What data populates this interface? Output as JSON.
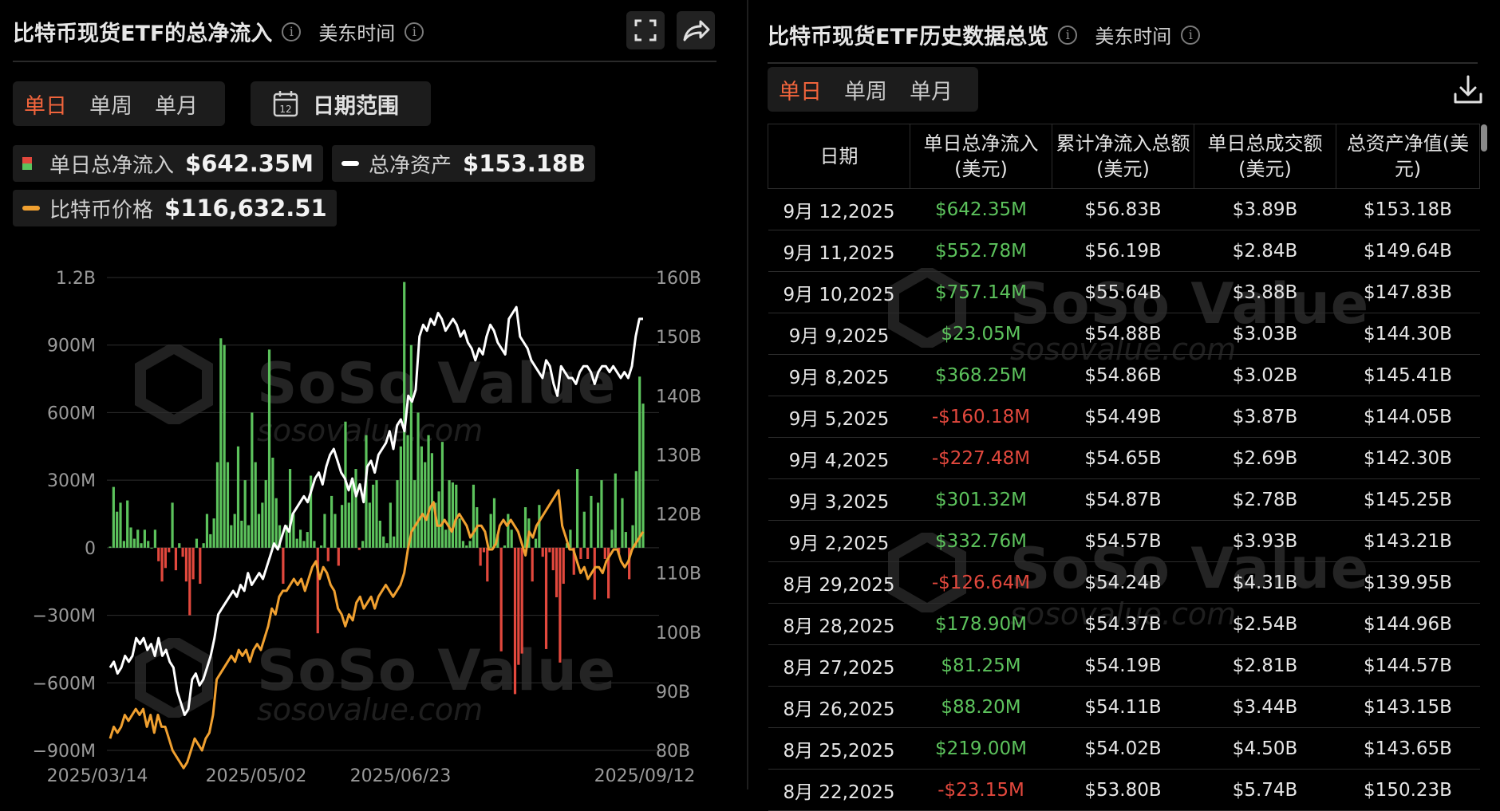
{
  "left": {
    "title": "比特币现货ETF的总净流入",
    "timezone": "美东时间",
    "tabs": [
      "单日",
      "单周",
      "单月"
    ],
    "active_tab": "单日",
    "date_range_label": "日期范围",
    "legend": {
      "net_inflow_label": "单日总净流入",
      "net_inflow_value": "$642.35M",
      "net_assets_label": "总净资产",
      "net_assets_value": "$153.18B",
      "btc_price_label": "比特币价格",
      "btc_price_value": "$116,632.51"
    },
    "colors": {
      "positive": "#5cc25c",
      "negative": "#e2483d",
      "net_assets_line": "#ffffff",
      "btc_price_line": "#f0a030",
      "accent": "#f0643c"
    }
  },
  "chart_data": {
    "type": "bar",
    "title": "比特币现货ETF的总净流入",
    "x_ticks": [
      "2025/03/14",
      "2025/05/02",
      "2025/06/23",
      "2025/09/12"
    ],
    "y_left_ticks": [
      "1.2B",
      "900M",
      "600M",
      "300M",
      "0",
      "−300M",
      "−600M",
      "−900M"
    ],
    "y_left_range": [
      -900,
      1200
    ],
    "y_left_unit": "M",
    "y_right_ticks": [
      "160B",
      "150B",
      "140B",
      "130B",
      "120B",
      "110B",
      "100B",
      "90B",
      "80B"
    ],
    "y_right_range": [
      80,
      160
    ],
    "grid": true,
    "series": [
      {
        "name": "单日总净流入",
        "kind": "bar",
        "values": [
          5,
          270,
          160,
          200,
          30,
          210,
          90,
          40,
          80,
          20,
          80,
          30,
          0,
          80,
          -60,
          -150,
          -90,
          -20,
          200,
          -100,
          20,
          -40,
          -150,
          -300,
          -140,
          40,
          -160,
          20,
          150,
          60,
          130,
          380,
          930,
          900,
          380,
          100,
          150,
          450,
          120,
          300,
          100,
          600,
          380,
          150,
          200,
          300,
          880,
          400,
          220,
          100,
          -160,
          100,
          350,
          150,
          40,
          80,
          30,
          70,
          320,
          30,
          -380,
          10,
          150,
          -60,
          230,
          150,
          -80,
          190,
          560,
          200,
          300,
          350,
          -10,
          30,
          500,
          200,
          280,
          300,
          120,
          50,
          20,
          200,
          50,
          300,
          450,
          1180,
          500,
          900,
          300,
          600,
          450,
          380,
          500,
          420,
          200,
          250,
          470,
          80,
          300,
          290,
          280,
          130,
          30,
          10,
          30,
          280,
          180,
          -80,
          -20,
          -150,
          150,
          220,
          60,
          -460,
          10,
          150,
          80,
          -650,
          -520,
          -470,
          180,
          130,
          -150,
          40,
          190,
          -40,
          -450,
          -20,
          -100,
          -220,
          -510,
          -160,
          20,
          80,
          -120,
          350,
          -50,
          160,
          -50,
          230,
          -230,
          200,
          300,
          -50,
          -225,
          80,
          330,
          -25,
          220,
          70,
          -140,
          100,
          340,
          760,
          640
        ],
        "color_positive": "#5cc25c",
        "color_negative": "#e2483d"
      },
      {
        "name": "总净资产",
        "kind": "line",
        "axis": "right",
        "color": "#ffffff",
        "values": [
          94,
          95,
          93,
          94,
          96,
          95,
          96,
          99,
          98,
          99,
          97,
          98,
          96,
          99,
          96,
          97,
          95,
          94,
          90,
          88,
          86,
          87,
          92,
          93,
          91,
          92,
          94,
          96,
          99,
          103,
          104,
          105,
          106,
          107,
          106,
          108,
          107,
          110,
          108,
          109,
          110,
          109,
          111,
          113,
          115,
          114,
          116,
          118,
          117,
          120,
          121,
          122,
          123,
          122,
          124,
          126,
          127,
          125,
          128,
          130,
          131,
          129,
          127,
          126,
          124,
          126,
          123,
          125,
          122,
          128,
          129,
          127,
          130,
          131,
          132,
          134,
          131,
          135,
          136,
          134,
          140,
          139,
          141,
          150,
          152,
          151,
          153,
          152,
          154,
          153,
          151,
          152,
          153,
          152,
          150,
          151,
          149,
          148,
          146,
          148,
          147,
          150,
          152,
          151,
          149,
          148,
          147,
          153,
          154,
          155,
          150,
          149,
          148,
          146,
          145,
          144,
          143,
          146,
          145,
          142,
          140,
          145,
          144,
          143,
          143,
          142,
          144,
          145,
          145,
          144,
          142,
          144,
          145,
          145,
          144,
          145,
          144,
          143,
          144,
          143,
          145,
          150,
          153,
          153
        ]
      },
      {
        "name": "比特币价格",
        "kind": "line",
        "axis": "right",
        "color": "#f0a030",
        "values": [
          82,
          84,
          83,
          84,
          86,
          85,
          86,
          87,
          86,
          87,
          84,
          86,
          83,
          86,
          84,
          84,
          82,
          80,
          79,
          78,
          77,
          78,
          80,
          82,
          81,
          80,
          82,
          83,
          86,
          92,
          93,
          94,
          95,
          96,
          95,
          97,
          96,
          97,
          95,
          97,
          98,
          97,
          99,
          101,
          104,
          103,
          106,
          107,
          107,
          108,
          109,
          108,
          109,
          107,
          109,
          111,
          112,
          109,
          111,
          110,
          108,
          107,
          104,
          103,
          101,
          103,
          102,
          105,
          106,
          104,
          105,
          106,
          104,
          106,
          107,
          108,
          107,
          106,
          107,
          108,
          110,
          114,
          117,
          118,
          119,
          120,
          119,
          121,
          122,
          118,
          118,
          119,
          118,
          117,
          119,
          120,
          119,
          118,
          116,
          117,
          118,
          118,
          117,
          114,
          114,
          115,
          118,
          119,
          118,
          119,
          118,
          117,
          115,
          113,
          117,
          116,
          118,
          119,
          120,
          121,
          122,
          123,
          124,
          118,
          116,
          114,
          114,
          112,
          110,
          111,
          109,
          110,
          111,
          111,
          110,
          112,
          113,
          114,
          114,
          112,
          111,
          112,
          114,
          115,
          116,
          117
        ]
      }
    ]
  },
  "right": {
    "title": "比特币现货ETF历史数据总览",
    "timezone": "美东时间",
    "tabs": [
      "单日",
      "单周",
      "单月"
    ],
    "active_tab": "单日",
    "columns": [
      "日期",
      "单日总净流入(美元)",
      "累计净流入总额(美元)",
      "单日总成交额(美元)",
      "总资产净值(美元)"
    ],
    "rows": [
      [
        "9月 12,2025",
        "$642.35M",
        "$56.83B",
        "$3.89B",
        "$153.18B",
        "pos"
      ],
      [
        "9月 11,2025",
        "$552.78M",
        "$56.19B",
        "$2.84B",
        "$149.64B",
        "pos"
      ],
      [
        "9月 10,2025",
        "$757.14M",
        "$55.64B",
        "$3.88B",
        "$147.83B",
        "pos"
      ],
      [
        "9月 9,2025",
        "$23.05M",
        "$54.88B",
        "$3.03B",
        "$144.30B",
        "pos"
      ],
      [
        "9月 8,2025",
        "$368.25M",
        "$54.86B",
        "$3.02B",
        "$145.41B",
        "pos"
      ],
      [
        "9月 5,2025",
        "-$160.18M",
        "$54.49B",
        "$3.87B",
        "$144.05B",
        "neg"
      ],
      [
        "9月 4,2025",
        "-$227.48M",
        "$54.65B",
        "$2.69B",
        "$142.30B",
        "neg"
      ],
      [
        "9月 3,2025",
        "$301.32M",
        "$54.87B",
        "$2.78B",
        "$145.25B",
        "pos"
      ],
      [
        "9月 2,2025",
        "$332.76M",
        "$54.57B",
        "$3.93B",
        "$143.21B",
        "pos"
      ],
      [
        "8月 29,2025",
        "-$126.64M",
        "$54.24B",
        "$4.31B",
        "$139.95B",
        "neg"
      ],
      [
        "8月 28,2025",
        "$178.90M",
        "$54.37B",
        "$2.54B",
        "$144.96B",
        "pos"
      ],
      [
        "8月 27,2025",
        "$81.25M",
        "$54.19B",
        "$2.81B",
        "$144.57B",
        "pos"
      ],
      [
        "8月 26,2025",
        "$88.20M",
        "$54.11B",
        "$3.44B",
        "$143.15B",
        "pos"
      ],
      [
        "8月 25,2025",
        "$219.00M",
        "$54.02B",
        "$4.50B",
        "$143.65B",
        "pos"
      ],
      [
        "8月 22,2025",
        "-$23.15M",
        "$53.80B",
        "$5.74B",
        "$150.23B",
        "neg"
      ]
    ]
  },
  "watermark": {
    "brand": "SoSo Value",
    "url": "sosovalue.com"
  },
  "icons": {
    "info": "info-icon",
    "fullscreen": "fullscreen-icon",
    "share": "share-icon",
    "calendar": "calendar-icon",
    "download": "download-icon"
  }
}
